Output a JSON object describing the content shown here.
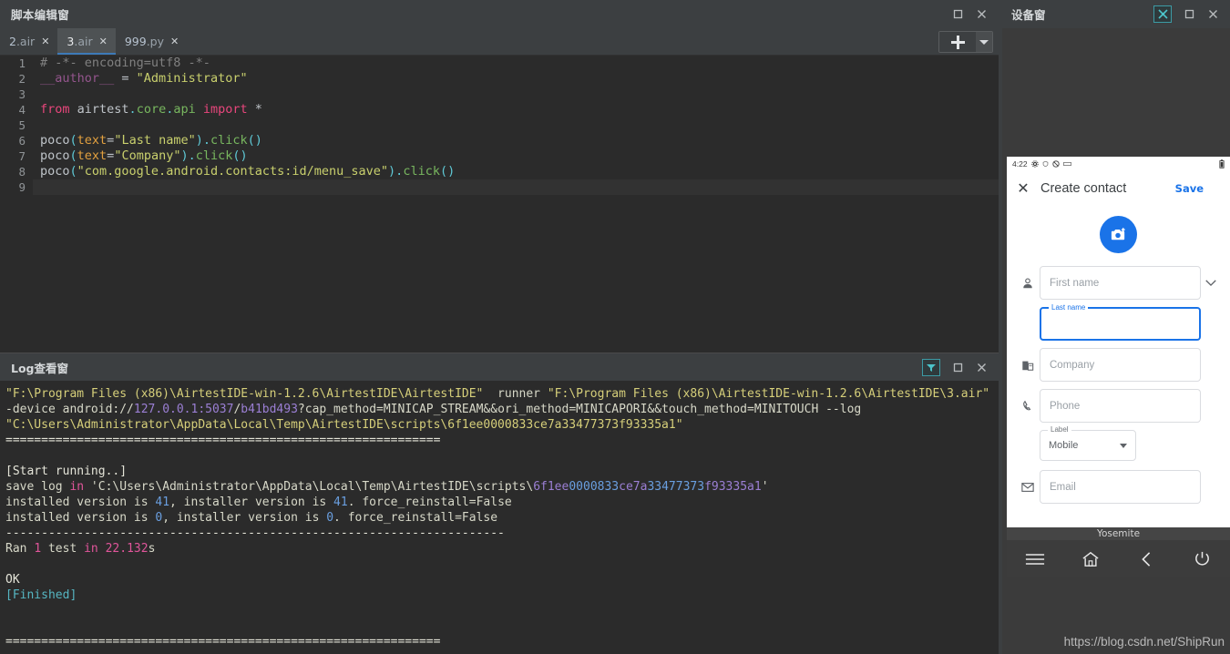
{
  "script_window": {
    "title": "脚本编辑窗",
    "controls": {
      "maximize": "maximize-icon",
      "close": "close-icon"
    },
    "tabs": [
      {
        "name": "2",
        "ext": ".air",
        "close": "✕",
        "active": false
      },
      {
        "name": "3",
        "ext": ".air",
        "close": "✕",
        "active": true
      },
      {
        "name": "999",
        "ext": ".py",
        "close": "✕",
        "active": false
      }
    ],
    "add_button": {
      "label": "+",
      "caret": "▼"
    },
    "code_lines": [
      {
        "num": "1",
        "tokens": [
          {
            "t": "# -*- encoding=utf8 -*-",
            "c": "t-comment"
          }
        ]
      },
      {
        "num": "2",
        "tokens": [
          {
            "t": "__author__",
            "c": "t-self"
          },
          {
            "t": " = ",
            "c": "t-plain"
          },
          {
            "t": "\"Administrator\"",
            "c": "t-str"
          }
        ]
      },
      {
        "num": "3",
        "tokens": []
      },
      {
        "num": "4",
        "tokens": [
          {
            "t": "from",
            "c": "t-kw2"
          },
          {
            "t": " airtest",
            "c": "t-plain"
          },
          {
            "t": ".",
            "c": "t-punc"
          },
          {
            "t": "core",
            "c": "t-fn"
          },
          {
            "t": ".",
            "c": "t-punc"
          },
          {
            "t": "api ",
            "c": "t-fn"
          },
          {
            "t": "import",
            "c": "t-kw2"
          },
          {
            "t": " *",
            "c": "t-plain"
          }
        ]
      },
      {
        "num": "5",
        "tokens": []
      },
      {
        "num": "6",
        "tokens": [
          {
            "t": "poco",
            "c": "t-plain"
          },
          {
            "t": "(",
            "c": "t-punc"
          },
          {
            "t": "text",
            "c": "t-attr"
          },
          {
            "t": "=",
            "c": "t-plain"
          },
          {
            "t": "\"Last name\"",
            "c": "t-str"
          },
          {
            "t": ")",
            "c": "t-punc"
          },
          {
            "t": ".",
            "c": "t-punc"
          },
          {
            "t": "click",
            "c": "t-fn"
          },
          {
            "t": "()",
            "c": "t-punc"
          }
        ]
      },
      {
        "num": "7",
        "tokens": [
          {
            "t": "poco",
            "c": "t-plain"
          },
          {
            "t": "(",
            "c": "t-punc"
          },
          {
            "t": "text",
            "c": "t-attr"
          },
          {
            "t": "=",
            "c": "t-plain"
          },
          {
            "t": "\"Company\"",
            "c": "t-str"
          },
          {
            "t": ")",
            "c": "t-punc"
          },
          {
            "t": ".",
            "c": "t-punc"
          },
          {
            "t": "click",
            "c": "t-fn"
          },
          {
            "t": "()",
            "c": "t-punc"
          }
        ]
      },
      {
        "num": "8",
        "tokens": [
          {
            "t": "poco",
            "c": "t-plain"
          },
          {
            "t": "(",
            "c": "t-punc"
          },
          {
            "t": "\"com.google.android.contacts:id/menu_save\"",
            "c": "t-str"
          },
          {
            "t": ")",
            "c": "t-punc"
          },
          {
            "t": ".",
            "c": "t-punc"
          },
          {
            "t": "click",
            "c": "t-fn"
          },
          {
            "t": "()",
            "c": "t-punc"
          }
        ]
      },
      {
        "num": "9",
        "tokens": [],
        "current": true
      }
    ]
  },
  "log_window": {
    "title": "Log查看窗",
    "controls": {
      "filter": "filter-icon",
      "maximize": "maximize-icon",
      "close": "close-icon"
    },
    "lines": [
      [
        {
          "t": "\"F:\\Program Files (x86)\\AirtestIDE-win-1.2.6\\AirtestIDE\\AirtestIDE\"",
          "c": "l-yellow"
        },
        {
          "t": "  runner ",
          "c": "l-default"
        },
        {
          "t": "\"F:\\Program Files (x86)\\AirtestIDE-win-1.2.6\\AirtestIDE\\3.air\"",
          "c": "l-yellow"
        },
        {
          "t": "  -",
          "c": "l-default"
        }
      ],
      [
        {
          "t": "-device android://",
          "c": "l-default"
        },
        {
          "t": "127.0.0.1:5037",
          "c": "l-purple"
        },
        {
          "t": "/",
          "c": "l-default"
        },
        {
          "t": "b41bd493",
          "c": "l-purple"
        },
        {
          "t": "?cap_method=MINICAP_STREAM&&ori_method=MINICAPORI&&touch_method=MINITOUCH --log",
          "c": "l-default"
        }
      ],
      [
        {
          "t": "\"C:\\Users\\Administrator\\AppData\\Local\\Temp\\AirtestIDE\\scripts\\6f1ee0000833ce7a33477373f93335a1\"",
          "c": "l-yellow"
        }
      ],
      [
        {
          "t": "=============================================================",
          "c": "l-white"
        }
      ],
      [],
      [
        {
          "t": "[Start running..]",
          "c": "l-white"
        }
      ],
      [
        {
          "t": "save log ",
          "c": "l-default"
        },
        {
          "t": "in",
          "c": "l-pink"
        },
        {
          "t": " 'C:\\Users\\Administrator\\AppData\\Local\\Temp\\AirtestIDE\\scripts\\",
          "c": "l-default"
        },
        {
          "t": "6f1ee",
          "c": "l-purple"
        },
        {
          "t": "0000833",
          "c": "l-blue"
        },
        {
          "t": "ce7a",
          "c": "l-purple"
        },
        {
          "t": "33477373",
          "c": "l-blue"
        },
        {
          "t": "f93335a1",
          "c": "l-purple"
        },
        {
          "t": "'",
          "c": "l-default"
        }
      ],
      [
        {
          "t": "installed version is ",
          "c": "l-default"
        },
        {
          "t": "41",
          "c": "l-blue"
        },
        {
          "t": ", installer version is ",
          "c": "l-default"
        },
        {
          "t": "41",
          "c": "l-blue"
        },
        {
          "t": ". force_reinstall=False",
          "c": "l-default"
        }
      ],
      [
        {
          "t": "installed version is ",
          "c": "l-default"
        },
        {
          "t": "0",
          "c": "l-blue"
        },
        {
          "t": ", installer version is ",
          "c": "l-default"
        },
        {
          "t": "0",
          "c": "l-blue"
        },
        {
          "t": ". force_reinstall=False",
          "c": "l-default"
        }
      ],
      [
        {
          "t": "----------------------------------------------------------------------",
          "c": "l-white"
        }
      ],
      [
        {
          "t": "Ran ",
          "c": "l-default"
        },
        {
          "t": "1",
          "c": "l-pink"
        },
        {
          "t": " test ",
          "c": "l-default"
        },
        {
          "t": "in",
          "c": "l-pink"
        },
        {
          "t": " ",
          "c": "l-default"
        },
        {
          "t": "22.132",
          "c": "l-pink"
        },
        {
          "t": "s",
          "c": "l-default"
        }
      ],
      [],
      [
        {
          "t": "OK",
          "c": "l-white"
        }
      ],
      [
        {
          "t": "[Finished]",
          "c": "l-cyan"
        }
      ],
      [],
      [],
      [
        {
          "t": "=============================================================",
          "c": "l-white"
        }
      ]
    ]
  },
  "device_window": {
    "title": "设备窗",
    "controls": {
      "tool": "airtest-tool-icon",
      "maximize": "maximize-icon",
      "close": "close-icon"
    },
    "phone": {
      "status_bar": {
        "time": "4:22",
        "icons": [
          "gear-icon",
          "shield-icon",
          "no-sound-icon",
          "key-icon"
        ],
        "battery": "battery-icon"
      },
      "appbar": {
        "close": "✕",
        "title": "Create contact",
        "save": "Save",
        "overflow": "kebab-icon"
      },
      "photo_button": "add-photo-icon",
      "fields": [
        {
          "icon": "person-icon",
          "placeholder": "First name",
          "value": "",
          "focused": false,
          "expand": "chevron-down-icon"
        },
        {
          "icon": "",
          "placeholder": "",
          "value": "",
          "focused": true,
          "label": "Last name"
        },
        {
          "icon": "company-icon",
          "placeholder": "Company",
          "value": "",
          "focused": false
        },
        {
          "icon": "phone-icon",
          "placeholder": "Phone",
          "value": "",
          "focused": false
        },
        {
          "icon": "mail-icon",
          "placeholder": "Email",
          "value": "",
          "focused": false
        }
      ],
      "label_select": {
        "label": "Label",
        "value": "Mobile",
        "caret": "▼"
      }
    },
    "device_name": "Yosemite",
    "nav_buttons": [
      "menu-icon",
      "home-icon",
      "back-icon",
      "power-icon"
    ]
  },
  "watermark": "https://blog.csdn.net/ShipRun"
}
